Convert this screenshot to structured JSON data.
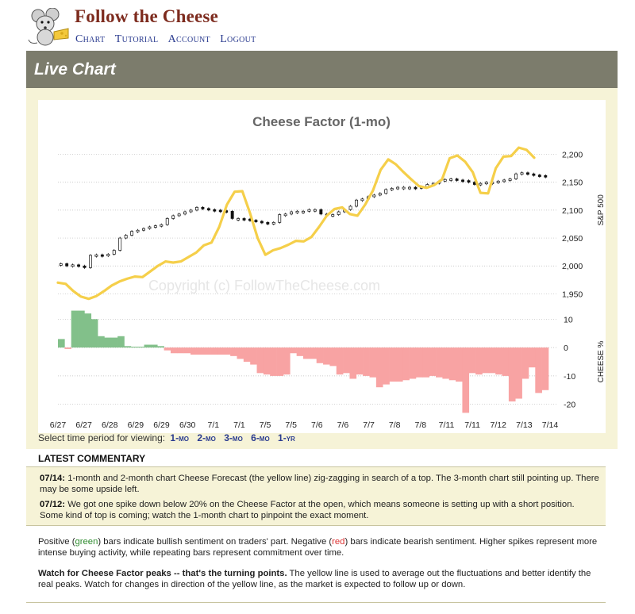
{
  "site": {
    "title": "Follow the Cheese"
  },
  "nav": {
    "items": [
      "Chart",
      "Tutorial",
      "Account",
      "Logout"
    ]
  },
  "section": {
    "title": "Live Chart"
  },
  "watermark": "Copyright (c) FollowTheCheese.com",
  "colors": {
    "cheese_line": "#f5cf4a",
    "bull_bar": "#82c08a",
    "bear_bar": "#f8a3a3",
    "section_bar": "#7c7c6c",
    "panel_bg": "#f6f3d7",
    "title_red": "#7d2b1e",
    "link_blue": "#2a3b8f"
  },
  "chart_data": {
    "type": "line",
    "title": "Cheese Factor (1-mo)",
    "x_labels": [
      "6/27",
      "6/27",
      "6/28",
      "6/29",
      "6/29",
      "6/30",
      "7/1",
      "7/1",
      "7/5",
      "7/5",
      "7/6",
      "7/6",
      "7/7",
      "7/8",
      "7/8",
      "7/11",
      "7/11",
      "7/12",
      "7/13",
      "7/14"
    ],
    "price_axis": {
      "label": "S&P 500",
      "ticks": [
        1950,
        2000,
        2050,
        2100,
        2150,
        2200
      ],
      "ylim": [
        1925,
        2215
      ]
    },
    "cheese_axis": {
      "label": "CHEESE %",
      "ticks": [
        -20,
        -10,
        0,
        10
      ],
      "ylim": [
        -24,
        14
      ]
    },
    "series": [
      {
        "name": "S&P 500",
        "style": "candles",
        "values": [
          2004,
          2000,
          2002,
          2000,
          1997,
          2019,
          2020,
          2018,
          2021,
          2028,
          2050,
          2055,
          2062,
          2064,
          2067,
          2070,
          2072,
          2074,
          2085,
          2090,
          2093,
          2097,
          2100,
          2105,
          2103,
          2101,
          2100,
          2099,
          2098,
          2085,
          2085,
          2084,
          2082,
          2080,
          2078,
          2075,
          2078,
          2092,
          2093,
          2097,
          2098,
          2098,
          2101,
          2101,
          2093,
          2090,
          2092,
          2097,
          2101,
          2107,
          2118,
          2120,
          2124,
          2127,
          2130,
          2137,
          2139,
          2141,
          2141,
          2141,
          2140,
          2142,
          2146,
          2148,
          2152,
          2155,
          2156,
          2154,
          2153,
          2150,
          2146,
          2148,
          2150,
          2150,
          2152,
          2154,
          2156,
          2165,
          2167,
          2165,
          2163,
          2162,
          2160
        ]
      },
      {
        "name": "Cheese Factor",
        "style": "yellow-line",
        "values": [
          1970,
          1968,
          1955,
          1945,
          1941,
          1946,
          1955,
          1965,
          1972,
          1977,
          1981,
          1980,
          1990,
          2000,
          2008,
          2006,
          2008,
          2016,
          2024,
          2037,
          2042,
          2070,
          2110,
          2133,
          2134,
          2095,
          2050,
          2020,
          2028,
          2032,
          2038,
          2045,
          2044,
          2052,
          2070,
          2090,
          2102,
          2105,
          2093,
          2090,
          2110,
          2135,
          2172,
          2191,
          2182,
          2168,
          2155,
          2143,
          2140,
          2145,
          2155,
          2193,
          2198,
          2187,
          2168,
          2131,
          2130,
          2175,
          2196,
          2197,
          2212,
          2208,
          2194
        ]
      },
      {
        "name": "Cheese %",
        "style": "bars",
        "values": [
          3,
          -0.5,
          13,
          13,
          12,
          10,
          4,
          3.5,
          3.5,
          4,
          0.5,
          0.3,
          0.3,
          1,
          1,
          0.5,
          -1,
          -2,
          -2,
          -2,
          -2.5,
          -2.5,
          -2.5,
          -2.5,
          -2.5,
          -2.5,
          -3,
          -4,
          -5,
          -6,
          -9,
          -9.5,
          -10,
          -10,
          -9.5,
          -2,
          -3,
          -4,
          -4,
          -5.5,
          -6,
          -6.5,
          -9.5,
          -9,
          -11,
          -9.5,
          -10,
          -10.5,
          -14,
          -13,
          -12,
          -12,
          -11.5,
          -11,
          -10.5,
          -10.5,
          -10,
          -10.5,
          -11,
          -11.5,
          -12,
          -23,
          -9,
          -9.5,
          -9,
          -9,
          -9.5,
          -10,
          -19,
          -18,
          -11,
          -7,
          -16,
          -15
        ]
      }
    ]
  },
  "period": {
    "prompt": "Select time period for viewing:",
    "options": [
      "1-mo",
      "2-mo",
      "3-mo",
      "6-mo",
      "1-yr"
    ]
  },
  "commentary": {
    "heading": "LATEST COMMENTARY",
    "entries": [
      {
        "date": "07/14:",
        "text": "1-month and 2-month chart Cheese Forecast (the yellow line) zig-zagging in search of a top. The 3-month chart still pointing up. There may be some upside left."
      },
      {
        "date": "07/12:",
        "text": "We got one spike down below 20% on the Cheese Factor at the open, which means someone is setting up with a short position. Some kind of top is coming; watch the 1-month chart to pinpoint the exact moment."
      }
    ]
  },
  "legend": {
    "p1_a": "Positive (",
    "p1_green": "green",
    "p1_b": ") bars indicate bullish sentiment on traders' part. Negative (",
    "p1_red": "red",
    "p1_c": ") bars indicate bearish sentiment. Higher spikes represent more intense buying activity, while repeating bars represent commitment over time.",
    "p2_bold": "Watch for Cheese Factor peaks -- that's the turning points.",
    "p2_rest": " The yellow line is used to average out the fluctuations and better identify the real peaks. Watch for changes in direction of the yellow line, as the market is expected to follow up or down."
  }
}
